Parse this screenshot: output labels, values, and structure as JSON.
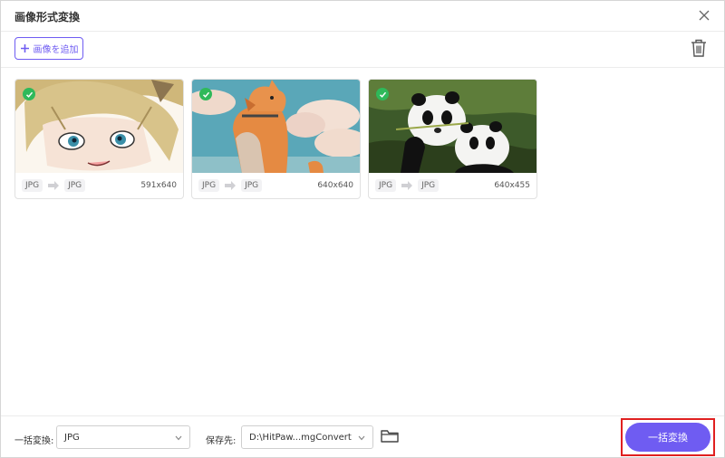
{
  "window": {
    "title": "画像形式変換"
  },
  "toolbar": {
    "add_label": "画像を追加"
  },
  "cards": [
    {
      "from": "JPG",
      "to": "JPG",
      "dims": "591x640",
      "checked": true,
      "subject": "anime-character"
    },
    {
      "from": "JPG",
      "to": "JPG",
      "dims": "640x640",
      "checked": true,
      "subject": "cat-illustration"
    },
    {
      "from": "JPG",
      "to": "JPG",
      "dims": "640x455",
      "checked": true,
      "subject": "pandas-photo"
    }
  ],
  "bottom": {
    "bulk_label": "一括変換:",
    "bulk_value": "JPG",
    "save_label": "保存先:",
    "save_value": "D:\\HitPaw...mgConvert",
    "convert_label": "一括変換"
  },
  "colors": {
    "accent": "#6f5cf2",
    "check": "#2fb95a",
    "highlight": "#e02020"
  }
}
